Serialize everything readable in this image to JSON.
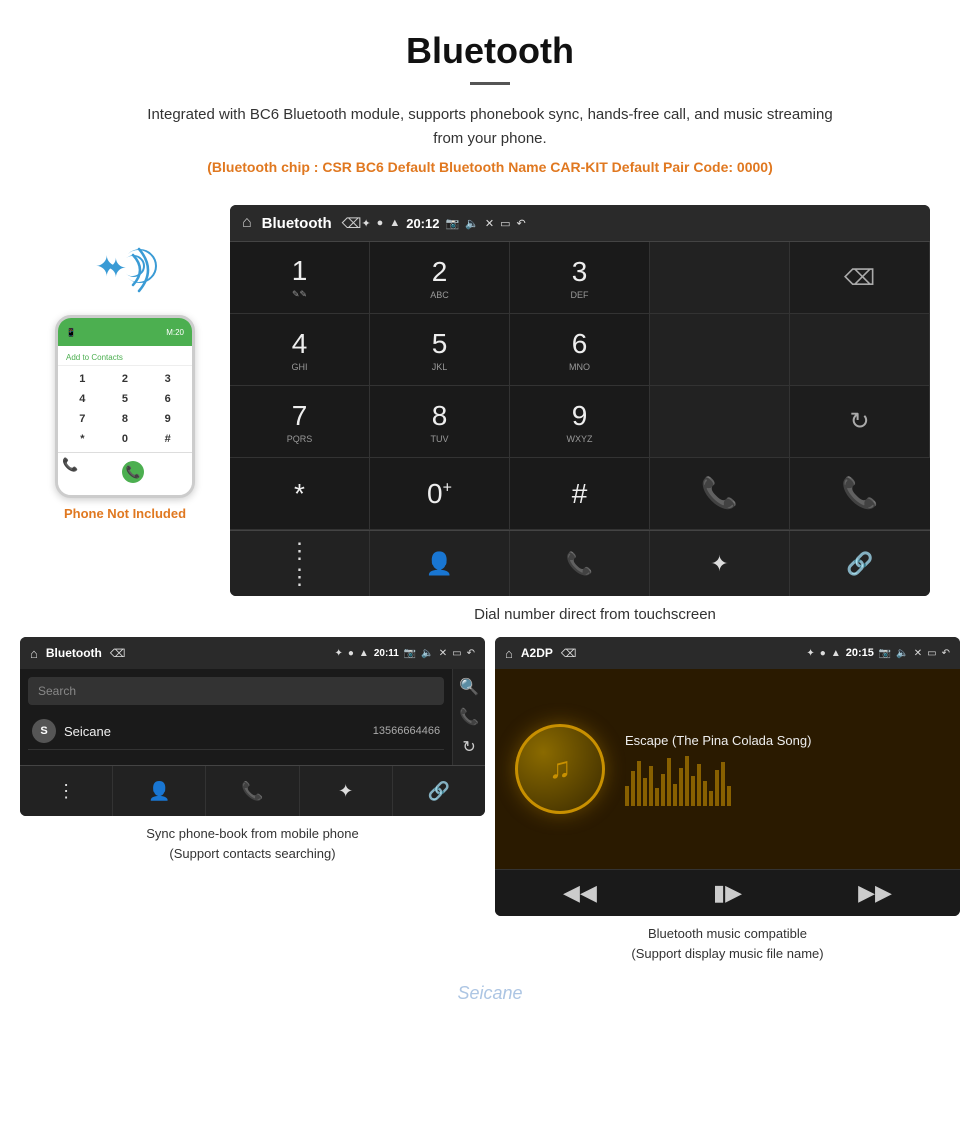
{
  "header": {
    "title": "Bluetooth",
    "description": "Integrated with BC6 Bluetooth module, supports phonebook sync, hands-free call, and music streaming from your phone.",
    "specs": "(Bluetooth chip : CSR BC6    Default Bluetooth Name CAR-KIT    Default Pair Code: 0000)"
  },
  "phone_mockup": {
    "not_included_label": "Phone Not Included",
    "top_bar_text": "M:20",
    "add_contact": "Add to Contacts",
    "keys": [
      "1",
      "2",
      "3",
      "4",
      "5",
      "6",
      "7",
      "8",
      "9",
      "*",
      "0",
      "#"
    ]
  },
  "dial_screen": {
    "status_bar": {
      "title": "Bluetooth",
      "time": "20:12"
    },
    "keys": [
      {
        "num": "1",
        "letters": "∿∿"
      },
      {
        "num": "2",
        "letters": "ABC"
      },
      {
        "num": "3",
        "letters": "DEF"
      },
      {
        "num": "4",
        "letters": "GHI"
      },
      {
        "num": "5",
        "letters": "JKL"
      },
      {
        "num": "6",
        "letters": "MNO"
      },
      {
        "num": "7",
        "letters": "PQRS"
      },
      {
        "num": "8",
        "letters": "TUV"
      },
      {
        "num": "9",
        "letters": "WXYZ"
      },
      {
        "num": "*",
        "letters": ""
      },
      {
        "num": "0",
        "letters": "+"
      },
      {
        "num": "#",
        "letters": ""
      }
    ],
    "caption": "Dial number direct from touchscreen"
  },
  "phonebook_screen": {
    "status_bar": {
      "title": "Bluetooth",
      "time": "20:11"
    },
    "search_placeholder": "Search",
    "contact": {
      "initial": "S",
      "name": "Seicane",
      "phone": "13566664466"
    },
    "caption_line1": "Sync phone-book from mobile phone",
    "caption_line2": "(Support contacts searching)"
  },
  "music_screen": {
    "status_bar": {
      "title": "A2DP",
      "time": "20:15"
    },
    "song_title": "Escape (The Pina Colada Song)",
    "caption_line1": "Bluetooth music compatible",
    "caption_line2": "(Support display music file name)"
  },
  "colors": {
    "orange": "#e07820",
    "green": "#4caf50",
    "red": "#e53935",
    "blue": "#3a9bd5"
  }
}
